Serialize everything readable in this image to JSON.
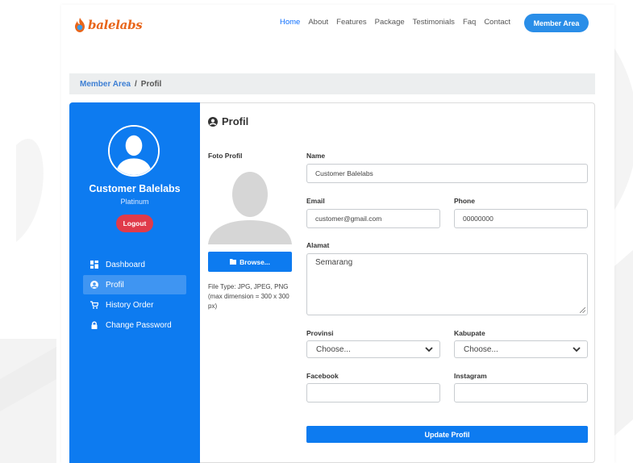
{
  "brand": {
    "name": "balelabs",
    "accent_color": "#0d7bf0",
    "brand_color": "#e8651a"
  },
  "nav": {
    "links": [
      "Home",
      "About",
      "Features",
      "Package",
      "Testimonials",
      "Faq",
      "Contact"
    ],
    "active": "Home",
    "member_button": "Member Area"
  },
  "breadcrumb": {
    "parent": "Member Area",
    "separator": "/",
    "current": "Profil"
  },
  "sidebar": {
    "user_name": "Customer Balelabs",
    "level": "Platinum",
    "logout_label": "Logout",
    "menu": [
      {
        "label": "Dashboard",
        "icon": "dashboard-icon"
      },
      {
        "label": "Profil",
        "icon": "user-circle-icon",
        "active": true
      },
      {
        "label": "History Order",
        "icon": "cart-icon"
      },
      {
        "label": "Change Password",
        "icon": "lock-icon"
      }
    ]
  },
  "main": {
    "title": "Profil",
    "photo": {
      "label": "Foto Profil",
      "browse_label": "Browse...",
      "note": "File Type: JPG, JPEG, PNG (max dimension = 300 x 300 px)"
    },
    "fields": {
      "name": {
        "label": "Name",
        "value": "Customer Balelabs"
      },
      "email": {
        "label": "Email",
        "value": "customer@gmail.com"
      },
      "phone": {
        "label": "Phone",
        "value": "00000000"
      },
      "alamat": {
        "label": "Alamat",
        "value": "Semarang"
      },
      "provinsi": {
        "label": "Provinsi",
        "value": "Choose..."
      },
      "kabupaten": {
        "label": "Kabupate",
        "value": "Choose..."
      },
      "facebook": {
        "label": "Facebook",
        "value": ""
      },
      "instagram": {
        "label": "Instagram",
        "value": ""
      }
    },
    "submit_label": "Update Profil"
  }
}
